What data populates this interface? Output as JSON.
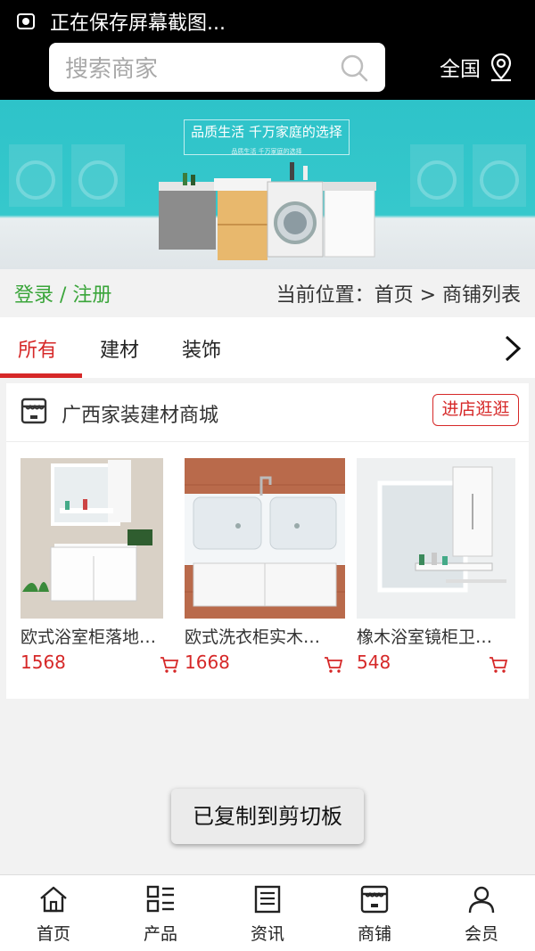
{
  "status_bar": {
    "text": "正在保存屏幕截图..."
  },
  "search": {
    "placeholder": "搜索商家"
  },
  "region": {
    "label": "全国"
  },
  "banner": {
    "slogan": "品质生活  千万家庭的选择",
    "slogan_small": "品质生活 千万家庭的选择"
  },
  "breadcrumb": {
    "login": "登录 / 注册",
    "location": "当前位置：首页 > 商铺列表"
  },
  "tabs": [
    {
      "label": "所有",
      "active": true
    },
    {
      "label": "建材",
      "active": false
    },
    {
      "label": "装饰",
      "active": false
    }
  ],
  "shop": {
    "name": "广西家装建材商城",
    "visit_label": "进店逛逛",
    "products": [
      {
        "name": "欧式浴室柜落地…",
        "price": "1568"
      },
      {
        "name": "欧式洗衣柜实木…",
        "price": "1668"
      },
      {
        "name": "橡木浴室镜柜卫…",
        "price": "548"
      }
    ]
  },
  "toast": {
    "text": "已复制到剪切板"
  },
  "bottom_nav": [
    {
      "label": "首页",
      "icon": "home-icon"
    },
    {
      "label": "产品",
      "icon": "grid-list-icon"
    },
    {
      "label": "资讯",
      "icon": "news-icon"
    },
    {
      "label": "商铺",
      "icon": "store-icon"
    },
    {
      "label": "会员",
      "icon": "user-icon"
    }
  ],
  "colors": {
    "accent": "#d62828",
    "login": "#3aa53a",
    "banner": "#36c8cc"
  }
}
